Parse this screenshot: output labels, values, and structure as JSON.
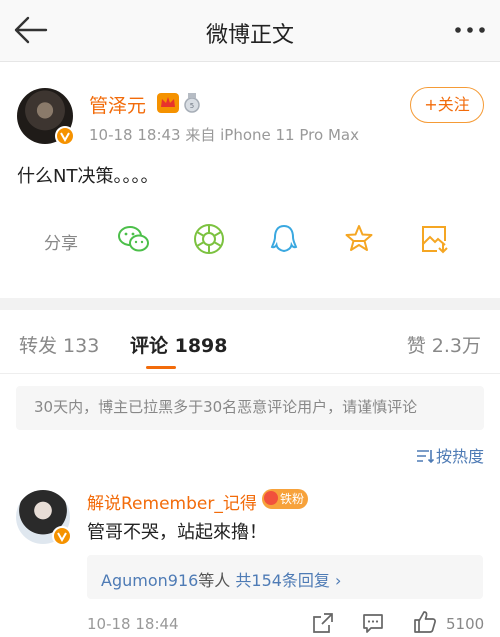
{
  "header": {
    "title": "微博正文"
  },
  "post": {
    "username": "管泽元",
    "meta": "10-18 18:43 来自 iPhone 11 Pro Max",
    "follow_label": "+关注",
    "content": "什么NT决策。。。。",
    "share_label": "分享"
  },
  "tabs": {
    "repost": "转发 133",
    "comment": "评论 1898",
    "like": "赞 2.3万"
  },
  "notice": "30天内，博主已拉黑多于30名恶意评论用户，请谨慎评论",
  "sort_label": "按热度",
  "comment": {
    "username": "解说Remember_记得",
    "fans_badge": "铁粉",
    "text": "管哥不哭，站起來擼！",
    "replies_user": "Agumon916",
    "replies_mid": "等人 ",
    "replies_count": "共154条回复 ›",
    "time": "10-18 18:44",
    "likes": "5100"
  },
  "colors": {
    "accent": "#f26b0a",
    "link": "#4e7bb5",
    "share_icon": "#f5a623"
  }
}
